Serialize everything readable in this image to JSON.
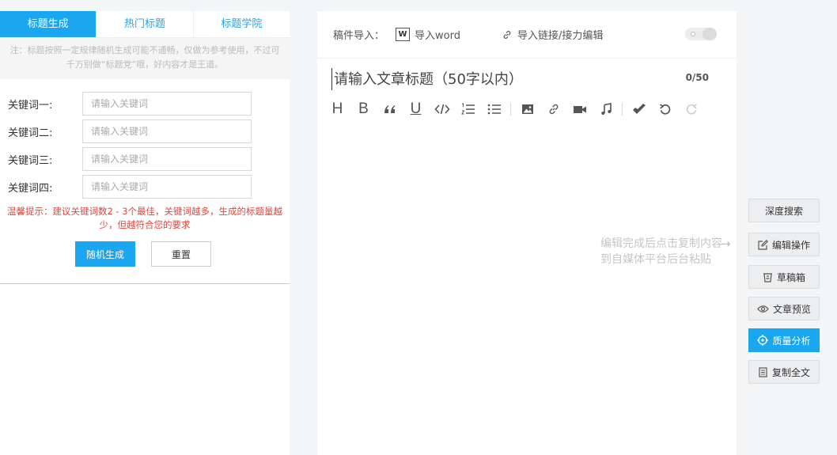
{
  "tabs": [
    "标题生成",
    "热门标题",
    "标题学院"
  ],
  "note": "注：标题按照一定规律随机生成可能不通畅，仅做为参考使用，不过可千万别做“标题党”哦，好内容才是王道。",
  "keywords": [
    {
      "label": "关键词一:",
      "placeholder": "请输入关键词"
    },
    {
      "label": "关键词二:",
      "placeholder": "请输入关键词"
    },
    {
      "label": "关键词三:",
      "placeholder": "请输入关键词"
    },
    {
      "label": "关键词四:",
      "placeholder": "请输入关键词"
    }
  ],
  "tip": "温馨提示：建议关键词数2 - 3个最佳，关键词越多，生成的标题量越少，但越符合您的要求",
  "actions": {
    "generate": "随机生成",
    "reset": "重置"
  },
  "import": {
    "label": "稿件导入：",
    "word_icon": "W",
    "word": "导入word",
    "link": "导入链接/接力编辑"
  },
  "editor": {
    "title_placeholder": "请输入文章标题（50字以内）",
    "counter": "0/50"
  },
  "hint": "编辑完成后点击复制内容到自媒体平台后台粘贴",
  "side_buttons": [
    "深度搜索",
    "编辑操作",
    "草稿箱",
    "文章预览",
    "质量分析",
    "复制全文"
  ],
  "colors": {
    "accent": "#1aa7f0",
    "tip": "#e3443b"
  }
}
